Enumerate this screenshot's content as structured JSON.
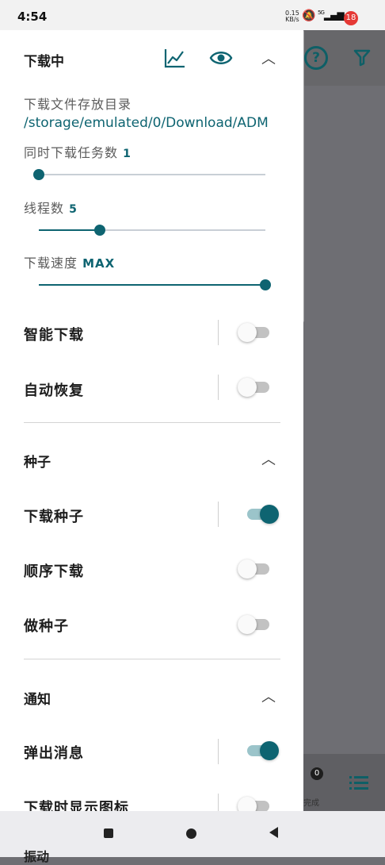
{
  "status": {
    "time": "4:54",
    "net_speed": "0.15\nKB/s",
    "network": "5G",
    "notif_count": "18"
  },
  "background": {
    "help_icon": "question-circle-icon",
    "filter_icon": "filter-icon",
    "done_badge": "0",
    "done_label": "完成",
    "list_icon": "list-icon",
    "accent": "#0e5f66"
  },
  "downloading": {
    "title": "下载中",
    "dir_label": "下载文件存放目录",
    "dir_path": "/storage/emulated/0/Download/ADM",
    "concurrent_label": "同时下载任务数",
    "concurrent_value": "1",
    "concurrent_fraction": 0,
    "threads_label": "线程数",
    "threads_value": "5",
    "threads_fraction": 0.27,
    "speed_label": "下载速度",
    "speed_value": "MAX",
    "speed_fraction": 1.0,
    "smart_label": "智能下载",
    "smart_on": false,
    "auto_resume_label": "自动恢复",
    "auto_resume_on": false
  },
  "torrent": {
    "title": "种子",
    "download_label": "下载种子",
    "download_on": true,
    "sequential_label": "顺序下载",
    "sequential_on": false,
    "seed_label": "做种子",
    "seed_on": false
  },
  "notify": {
    "title": "通知",
    "popup_label": "弹出消息",
    "popup_on": true,
    "show_icon_label": "下载时显示图标",
    "show_icon_on": false,
    "vibrate_label": "振动"
  },
  "colors": {
    "accent": "#0e6471",
    "scrim": "#6e6e73"
  }
}
